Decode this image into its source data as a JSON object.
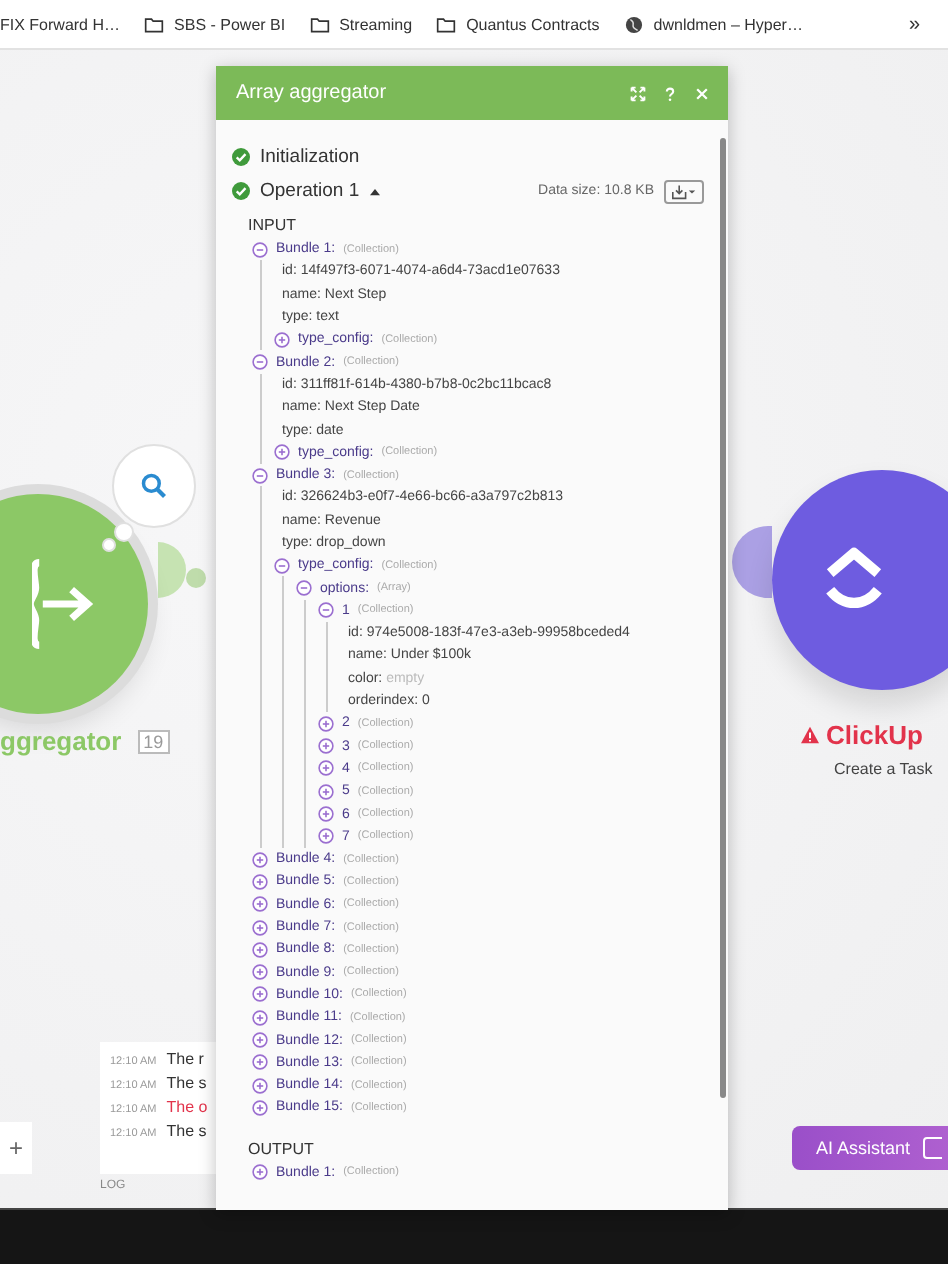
{
  "bookmarks": [
    {
      "label": "FIX Forward H…",
      "kind": "link"
    },
    {
      "label": "SBS - Power BI",
      "kind": "folder"
    },
    {
      "label": "Streaming",
      "kind": "folder"
    },
    {
      "label": "Quantus Contracts",
      "kind": "folder"
    },
    {
      "label": "dwnldmen – Hyper…",
      "kind": "site"
    }
  ],
  "bookmarks_more": "»",
  "modules": [
    {
      "kind": "aggregator",
      "name": "ggregator",
      "badge": "19",
      "warning": false
    },
    {
      "kind": "clickup",
      "name": "ClickUp",
      "subtitle": "Create a Task",
      "warning": true
    }
  ],
  "log": [
    {
      "time": "12:10 AM",
      "text": "The r",
      "error": false
    },
    {
      "time": "12:10 AM",
      "text": "The s",
      "error": false
    },
    {
      "time": "12:10 AM",
      "text": "The o",
      "error": true
    },
    {
      "time": "12:10 AM",
      "text": "The s",
      "error": false
    }
  ],
  "log_label": "LOG",
  "add_button": "+",
  "ai_button": "AI Assistant",
  "panel": {
    "title": "Array aggregator",
    "steps": [
      {
        "label": "Initialization",
        "done": true
      },
      {
        "label": "Operation 1",
        "done": true,
        "expanded": true
      }
    ],
    "data_size": "Data size: 10.8 KB",
    "sections": [
      {
        "title": "INPUT",
        "items": [
          {
            "kind": "collection",
            "label": "Bundle 1:",
            "type": "(Collection)",
            "expanded": true,
            "children": [
              {
                "kind": "field",
                "key": "id:",
                "value": "14f497f3-6071-4074-a6d4-73acd1e07633",
                "empty": false
              },
              {
                "kind": "field",
                "key": "name:",
                "value": "Next Step",
                "empty": false
              },
              {
                "kind": "field",
                "key": "type:",
                "value": "text",
                "empty": false
              },
              {
                "kind": "collection",
                "label": "type_config:",
                "type": "(Collection)",
                "expanded": false
              }
            ]
          },
          {
            "kind": "collection",
            "label": "Bundle 2:",
            "type": "(Collection)",
            "expanded": true,
            "children": [
              {
                "kind": "field",
                "key": "id:",
                "value": "311ff81f-614b-4380-b7b8-0c2bc11bcac8",
                "empty": false
              },
              {
                "kind": "field",
                "key": "name:",
                "value": "Next Step Date",
                "empty": false
              },
              {
                "kind": "field",
                "key": "type:",
                "value": "date",
                "empty": false
              },
              {
                "kind": "collection",
                "label": "type_config:",
                "type": "(Collection)",
                "expanded": false
              }
            ]
          },
          {
            "kind": "collection",
            "label": "Bundle 3:",
            "type": "(Collection)",
            "expanded": true,
            "children": [
              {
                "kind": "field",
                "key": "id:",
                "value": "326624b3-e0f7-4e66-bc66-a3a797c2b813",
                "empty": false
              },
              {
                "kind": "field",
                "key": "name:",
                "value": "Revenue",
                "empty": false
              },
              {
                "kind": "field",
                "key": "type:",
                "value": "drop_down",
                "empty": false
              },
              {
                "kind": "collection",
                "label": "type_config:",
                "type": "(Collection)",
                "expanded": true,
                "children": [
                  {
                    "kind": "collection",
                    "label": "options:",
                    "type": "(Array)",
                    "expanded": true,
                    "children": [
                      {
                        "kind": "collection",
                        "label": "1",
                        "type": "(Collection)",
                        "expanded": true,
                        "children": [
                          {
                            "kind": "field",
                            "key": "id:",
                            "value": "974e5008-183f-47e3-a3eb-99958bceded4",
                            "empty": false
                          },
                          {
                            "kind": "field",
                            "key": "name:",
                            "value": "Under $100k",
                            "empty": false
                          },
                          {
                            "kind": "field",
                            "key": "color:",
                            "value": "empty",
                            "empty": true
                          },
                          {
                            "kind": "field",
                            "key": "orderindex:",
                            "value": "0",
                            "empty": false
                          }
                        ]
                      },
                      {
                        "kind": "collection",
                        "label": "2",
                        "type": "(Collection)",
                        "expanded": false
                      },
                      {
                        "kind": "collection",
                        "label": "3",
                        "type": "(Collection)",
                        "expanded": false
                      },
                      {
                        "kind": "collection",
                        "label": "4",
                        "type": "(Collection)",
                        "expanded": false
                      },
                      {
                        "kind": "collection",
                        "label": "5",
                        "type": "(Collection)",
                        "expanded": false
                      },
                      {
                        "kind": "collection",
                        "label": "6",
                        "type": "(Collection)",
                        "expanded": false
                      },
                      {
                        "kind": "collection",
                        "label": "7",
                        "type": "(Collection)",
                        "expanded": false
                      }
                    ]
                  }
                ]
              }
            ]
          },
          {
            "kind": "collection",
            "label": "Bundle 4:",
            "type": "(Collection)",
            "expanded": false
          },
          {
            "kind": "collection",
            "label": "Bundle 5:",
            "type": "(Collection)",
            "expanded": false
          },
          {
            "kind": "collection",
            "label": "Bundle 6:",
            "type": "(Collection)",
            "expanded": false
          },
          {
            "kind": "collection",
            "label": "Bundle 7:",
            "type": "(Collection)",
            "expanded": false
          },
          {
            "kind": "collection",
            "label": "Bundle 8:",
            "type": "(Collection)",
            "expanded": false
          },
          {
            "kind": "collection",
            "label": "Bundle 9:",
            "type": "(Collection)",
            "expanded": false
          },
          {
            "kind": "collection",
            "label": "Bundle 10:",
            "type": "(Collection)",
            "expanded": false
          },
          {
            "kind": "collection",
            "label": "Bundle 11:",
            "type": "(Collection)",
            "expanded": false
          },
          {
            "kind": "collection",
            "label": "Bundle 12:",
            "type": "(Collection)",
            "expanded": false
          },
          {
            "kind": "collection",
            "label": "Bundle 13:",
            "type": "(Collection)",
            "expanded": false
          },
          {
            "kind": "collection",
            "label": "Bundle 14:",
            "type": "(Collection)",
            "expanded": false
          },
          {
            "kind": "collection",
            "label": "Bundle 15:",
            "type": "(Collection)",
            "expanded": false
          }
        ]
      },
      {
        "title": "OUTPUT",
        "items": [
          {
            "kind": "collection",
            "label": "Bundle 1:",
            "type": "(Collection)",
            "expanded": false
          }
        ]
      }
    ]
  }
}
